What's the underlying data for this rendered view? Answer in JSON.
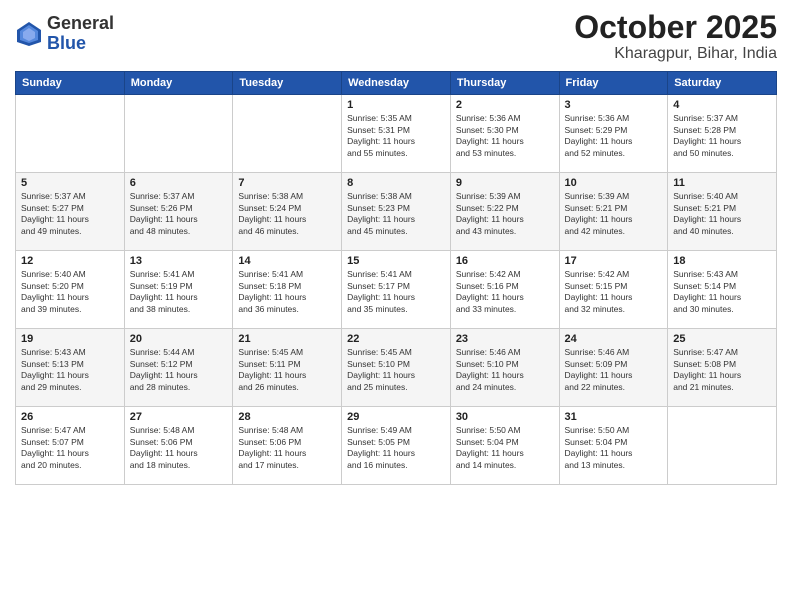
{
  "header": {
    "logo_general": "General",
    "logo_blue": "Blue",
    "month": "October 2025",
    "location": "Kharagpur, Bihar, India"
  },
  "weekdays": [
    "Sunday",
    "Monday",
    "Tuesday",
    "Wednesday",
    "Thursday",
    "Friday",
    "Saturday"
  ],
  "weeks": [
    [
      {
        "day": "",
        "info": ""
      },
      {
        "day": "",
        "info": ""
      },
      {
        "day": "",
        "info": ""
      },
      {
        "day": "1",
        "info": "Sunrise: 5:35 AM\nSunset: 5:31 PM\nDaylight: 11 hours\nand 55 minutes."
      },
      {
        "day": "2",
        "info": "Sunrise: 5:36 AM\nSunset: 5:30 PM\nDaylight: 11 hours\nand 53 minutes."
      },
      {
        "day": "3",
        "info": "Sunrise: 5:36 AM\nSunset: 5:29 PM\nDaylight: 11 hours\nand 52 minutes."
      },
      {
        "day": "4",
        "info": "Sunrise: 5:37 AM\nSunset: 5:28 PM\nDaylight: 11 hours\nand 50 minutes."
      }
    ],
    [
      {
        "day": "5",
        "info": "Sunrise: 5:37 AM\nSunset: 5:27 PM\nDaylight: 11 hours\nand 49 minutes."
      },
      {
        "day": "6",
        "info": "Sunrise: 5:37 AM\nSunset: 5:26 PM\nDaylight: 11 hours\nand 48 minutes."
      },
      {
        "day": "7",
        "info": "Sunrise: 5:38 AM\nSunset: 5:24 PM\nDaylight: 11 hours\nand 46 minutes."
      },
      {
        "day": "8",
        "info": "Sunrise: 5:38 AM\nSunset: 5:23 PM\nDaylight: 11 hours\nand 45 minutes."
      },
      {
        "day": "9",
        "info": "Sunrise: 5:39 AM\nSunset: 5:22 PM\nDaylight: 11 hours\nand 43 minutes."
      },
      {
        "day": "10",
        "info": "Sunrise: 5:39 AM\nSunset: 5:21 PM\nDaylight: 11 hours\nand 42 minutes."
      },
      {
        "day": "11",
        "info": "Sunrise: 5:40 AM\nSunset: 5:21 PM\nDaylight: 11 hours\nand 40 minutes."
      }
    ],
    [
      {
        "day": "12",
        "info": "Sunrise: 5:40 AM\nSunset: 5:20 PM\nDaylight: 11 hours\nand 39 minutes."
      },
      {
        "day": "13",
        "info": "Sunrise: 5:41 AM\nSunset: 5:19 PM\nDaylight: 11 hours\nand 38 minutes."
      },
      {
        "day": "14",
        "info": "Sunrise: 5:41 AM\nSunset: 5:18 PM\nDaylight: 11 hours\nand 36 minutes."
      },
      {
        "day": "15",
        "info": "Sunrise: 5:41 AM\nSunset: 5:17 PM\nDaylight: 11 hours\nand 35 minutes."
      },
      {
        "day": "16",
        "info": "Sunrise: 5:42 AM\nSunset: 5:16 PM\nDaylight: 11 hours\nand 33 minutes."
      },
      {
        "day": "17",
        "info": "Sunrise: 5:42 AM\nSunset: 5:15 PM\nDaylight: 11 hours\nand 32 minutes."
      },
      {
        "day": "18",
        "info": "Sunrise: 5:43 AM\nSunset: 5:14 PM\nDaylight: 11 hours\nand 30 minutes."
      }
    ],
    [
      {
        "day": "19",
        "info": "Sunrise: 5:43 AM\nSunset: 5:13 PM\nDaylight: 11 hours\nand 29 minutes."
      },
      {
        "day": "20",
        "info": "Sunrise: 5:44 AM\nSunset: 5:12 PM\nDaylight: 11 hours\nand 28 minutes."
      },
      {
        "day": "21",
        "info": "Sunrise: 5:45 AM\nSunset: 5:11 PM\nDaylight: 11 hours\nand 26 minutes."
      },
      {
        "day": "22",
        "info": "Sunrise: 5:45 AM\nSunset: 5:10 PM\nDaylight: 11 hours\nand 25 minutes."
      },
      {
        "day": "23",
        "info": "Sunrise: 5:46 AM\nSunset: 5:10 PM\nDaylight: 11 hours\nand 24 minutes."
      },
      {
        "day": "24",
        "info": "Sunrise: 5:46 AM\nSunset: 5:09 PM\nDaylight: 11 hours\nand 22 minutes."
      },
      {
        "day": "25",
        "info": "Sunrise: 5:47 AM\nSunset: 5:08 PM\nDaylight: 11 hours\nand 21 minutes."
      }
    ],
    [
      {
        "day": "26",
        "info": "Sunrise: 5:47 AM\nSunset: 5:07 PM\nDaylight: 11 hours\nand 20 minutes."
      },
      {
        "day": "27",
        "info": "Sunrise: 5:48 AM\nSunset: 5:06 PM\nDaylight: 11 hours\nand 18 minutes."
      },
      {
        "day": "28",
        "info": "Sunrise: 5:48 AM\nSunset: 5:06 PM\nDaylight: 11 hours\nand 17 minutes."
      },
      {
        "day": "29",
        "info": "Sunrise: 5:49 AM\nSunset: 5:05 PM\nDaylight: 11 hours\nand 16 minutes."
      },
      {
        "day": "30",
        "info": "Sunrise: 5:50 AM\nSunset: 5:04 PM\nDaylight: 11 hours\nand 14 minutes."
      },
      {
        "day": "31",
        "info": "Sunrise: 5:50 AM\nSunset: 5:04 PM\nDaylight: 11 hours\nand 13 minutes."
      },
      {
        "day": "",
        "info": ""
      }
    ]
  ]
}
